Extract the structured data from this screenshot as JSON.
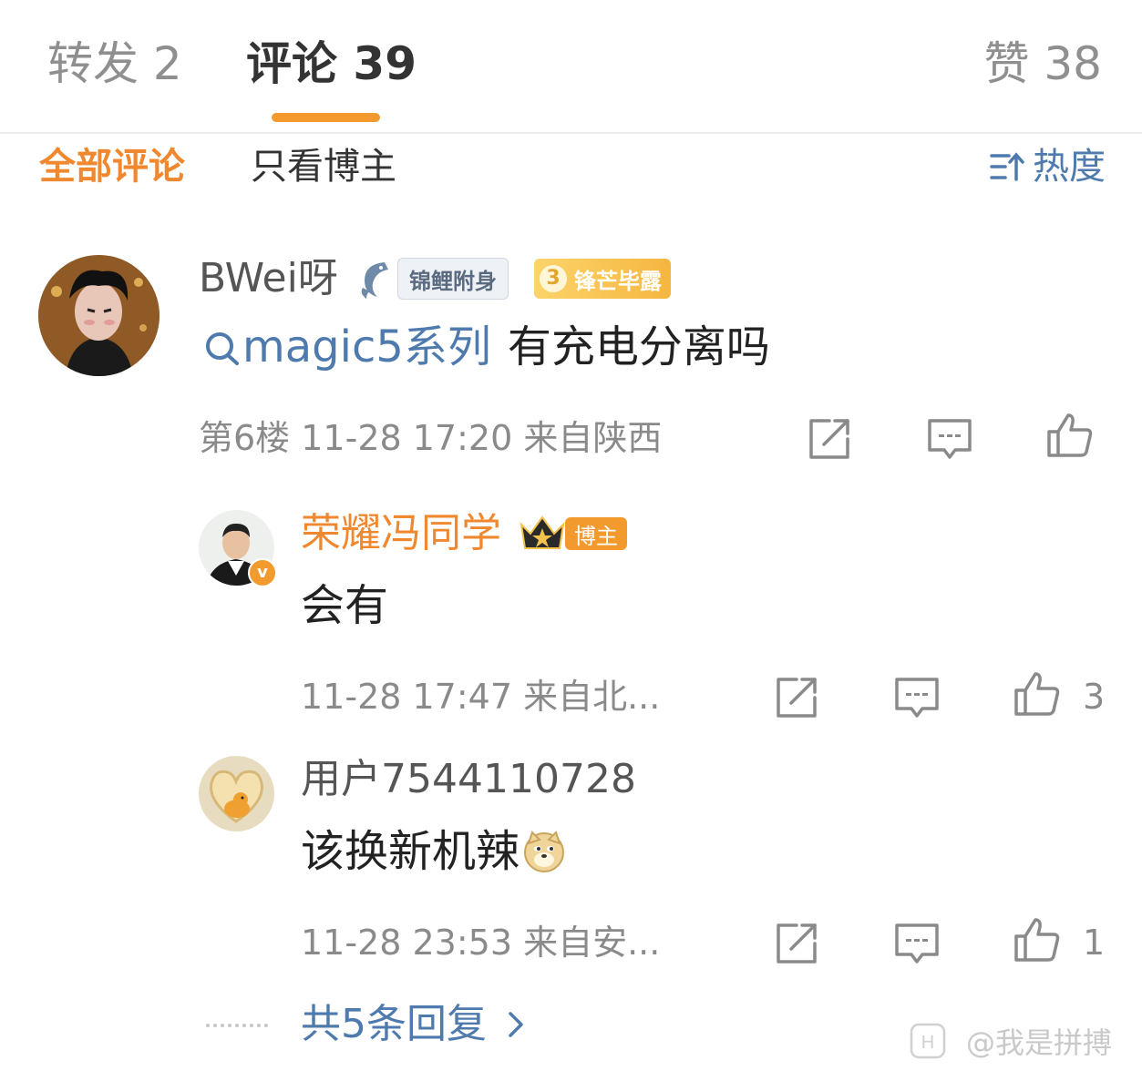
{
  "tabs": {
    "repost": "转发 2",
    "comment": "评论 39",
    "like": "赞 38"
  },
  "filters": {
    "all": "全部评论",
    "op_only": "只看博主",
    "sort": "热度"
  },
  "comment": {
    "username": "BWei呀",
    "badge1": "锦鲤附身",
    "badge2_level": "3",
    "badge2": "锋芒毕露",
    "topic": "magic5系列",
    "text": "有充电分离吗",
    "meta": "第6楼 11-28 17:20 来自陕西"
  },
  "replies": [
    {
      "username": "荣耀冯同学",
      "op_badge": "博主",
      "text": "会有",
      "meta": "11-28 17:47 来自北...",
      "likes": "3"
    },
    {
      "username": "用户7544110728",
      "text": "该换新机辣",
      "meta": "11-28 23:53 来自安...",
      "likes": "1"
    }
  ],
  "more_replies": "共5条回复",
  "watermark": "@我是拼搏",
  "colors": {
    "accent_orange": "#f0882f",
    "link_blue": "#4e7aad",
    "gray_text": "#8a8a8a"
  }
}
